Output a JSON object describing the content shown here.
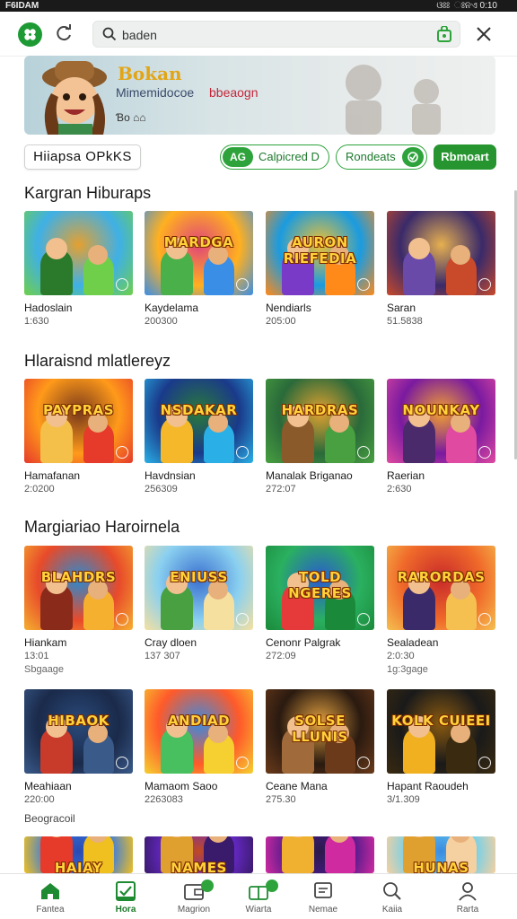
{
  "status_bar": {
    "left": "F6IDAM",
    "right": "ଓଃଃ ଃନଏ 0:10"
  },
  "search": {
    "placeholder": "",
    "value": "baden"
  },
  "banner": {
    "title": "Bokan",
    "subtitle": "Mimemidocoe",
    "accent": "bbeaogn",
    "foot": "Ɓo ⌂⌂"
  },
  "filters": {
    "region": "Hiiapsa OPkKS",
    "pill_a_badge": "AG",
    "pill_a_label": "Calpicred D",
    "pill_b_label": "Rondeats",
    "pill_c_label": "Rbmoart"
  },
  "sections": [
    {
      "title": "Kargran Hiburaps",
      "cards": [
        {
          "thumb_text": "",
          "name": "Hadoslain",
          "meta": "1:630",
          "extra": ""
        },
        {
          "thumb_text": "MARDGA",
          "name": "Kaydelama",
          "meta": "200300",
          "extra": ""
        },
        {
          "thumb_text": "AURON RIEFEDIA",
          "name": "Nendiarls",
          "meta": "205:00",
          "extra": ""
        },
        {
          "thumb_text": "",
          "name": "Saran",
          "meta": "51.5838",
          "extra": ""
        }
      ]
    },
    {
      "title": "Hlaraisnd mlatlereyz",
      "cards": [
        {
          "thumb_text": "PAYPRAS",
          "name": "Hamafanan",
          "meta": "2:0200",
          "extra": ""
        },
        {
          "thumb_text": "NSDAKAR",
          "name": "Havdnsian",
          "meta": "256309",
          "extra": ""
        },
        {
          "thumb_text": "HARDRAS",
          "name": "Manalak Briganao",
          "meta": "272:07",
          "extra": ""
        },
        {
          "thumb_text": "NOUNKAY",
          "name": "Raerian",
          "meta": "2:630",
          "extra": ""
        }
      ]
    },
    {
      "title": "Margiariao Haroirnela",
      "cards": [
        {
          "thumb_text": "BLAHDRS",
          "name": "Hiankam",
          "meta": "13:01",
          "extra": "Sbgaage"
        },
        {
          "thumb_text": "ENIUSS",
          "name": "Cray dloen",
          "meta": "137 307",
          "extra": ""
        },
        {
          "thumb_text": "TOLD NGERES",
          "name": "Cenonr Palgrak",
          "meta": "272:09",
          "extra": ""
        },
        {
          "thumb_text": "RARORDAS",
          "name": "Sealadean",
          "meta": "2:0:30",
          "extra": "1g:3gage"
        }
      ]
    },
    {
      "title": "",
      "cards": [
        {
          "thumb_text": "HIBAOK",
          "name": "Meahiaan",
          "meta": "220:00",
          "extra": ""
        },
        {
          "thumb_text": "ANDIAD",
          "name": "Mamaom Saoo",
          "meta": "2263083",
          "extra": ""
        },
        {
          "thumb_text": "SOLSE LLUNIS",
          "name": "Ceane Mana",
          "meta": "275.30",
          "extra": ""
        },
        {
          "thumb_text": "KOLK CUIEEI",
          "name": "Hapant Raoudeh",
          "meta": "3/1.309",
          "extra": ""
        }
      ]
    },
    {
      "title": "",
      "cards": [
        {
          "thumb_text": "HAIAY",
          "name": "",
          "meta": "",
          "extra": ""
        },
        {
          "thumb_text": "NAMES",
          "name": "",
          "meta": "",
          "extra": ""
        },
        {
          "thumb_text": "",
          "name": "",
          "meta": "",
          "extra": ""
        },
        {
          "thumb_text": "HUNAS KIJUDLAS",
          "name": "",
          "meta": "",
          "extra": ""
        }
      ]
    }
  ],
  "footer_note": "Beogracoil",
  "bottom_nav": [
    {
      "label": "Fantea",
      "icon": "home-icon"
    },
    {
      "label": "Hora",
      "icon": "check-box-icon"
    },
    {
      "label": "Magrion",
      "icon": "wallet-icon"
    },
    {
      "label": "Wiarta",
      "icon": "gift-icon"
    },
    {
      "label": "Nemae",
      "icon": "message-icon"
    },
    {
      "label": "Kaiia",
      "icon": "search-icon"
    },
    {
      "label": "Rarta",
      "icon": "profile-icon"
    }
  ],
  "colors": {
    "accent": "#2ea33b",
    "accent_dark": "#1e7a2c"
  }
}
